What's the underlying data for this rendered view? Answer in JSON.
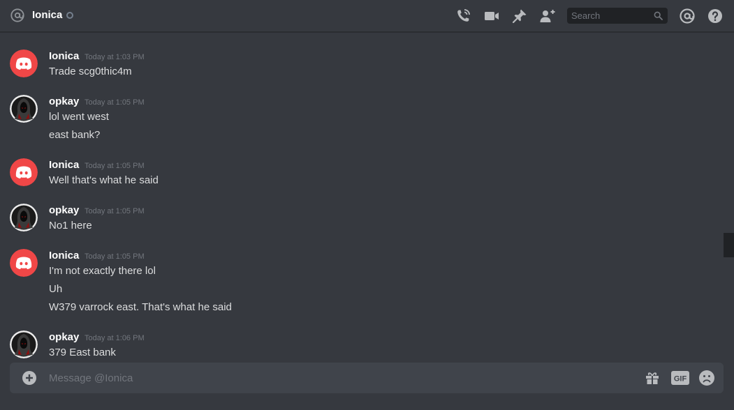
{
  "header": {
    "channel_name": "Ionica",
    "search_placeholder": "Search"
  },
  "messages": [
    {
      "author": "Ionica",
      "timestamp": "Today at 1:03 PM",
      "avatar": "discord-default-red",
      "lines": [
        "Trade scg0thic4m"
      ]
    },
    {
      "author": "opkay",
      "timestamp": "Today at 1:05 PM",
      "avatar": "hooded-figure",
      "lines": [
        "lol went west",
        "east bank?"
      ]
    },
    {
      "author": "Ionica",
      "timestamp": "Today at 1:05 PM",
      "avatar": "discord-default-red",
      "lines": [
        "Well that's what he said"
      ]
    },
    {
      "author": "opkay",
      "timestamp": "Today at 1:05 PM",
      "avatar": "hooded-figure",
      "lines": [
        "No1 here"
      ]
    },
    {
      "author": "Ionica",
      "timestamp": "Today at 1:05 PM",
      "avatar": "discord-default-red",
      "lines": [
        "I'm not exactly there lol",
        "Uh",
        "W379 varrock east. That's what he said"
      ]
    },
    {
      "author": "opkay",
      "timestamp": "Today at 1:06 PM",
      "avatar": "hooded-figure",
      "lines": [
        "379 East bank"
      ]
    }
  ],
  "composer": {
    "placeholder": "Message @Ionica",
    "gif_label": "GIF"
  },
  "colors": {
    "background": "#36393f",
    "composer_bg": "#40444b",
    "search_bg": "#202225",
    "discord_red": "#f04747",
    "username": "#ffffff",
    "message_text": "#dcddde",
    "timestamp": "#72767d",
    "icon": "#b9bbbe"
  }
}
